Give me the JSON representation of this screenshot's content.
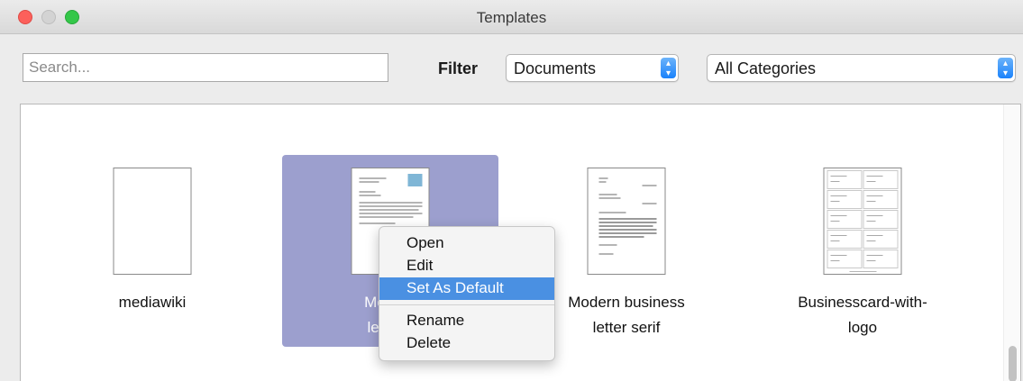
{
  "window": {
    "title": "Templates"
  },
  "search": {
    "placeholder": "Search..."
  },
  "filter": {
    "label": "Filter",
    "type_select": "Documents",
    "category_select": "All Categories"
  },
  "templates": [
    {
      "name": "mediawiki",
      "line1": "mediawiki",
      "line2": ""
    },
    {
      "name": "Modern business letter sans-serif",
      "line1": "Modern",
      "line2": "letter s",
      "selected": true
    },
    {
      "name": "Modern business letter serif",
      "line1": "Modern business",
      "line2": "letter serif"
    },
    {
      "name": "Businesscard-with-logo",
      "line1": "Businesscard-with-",
      "line2": "logo"
    }
  ],
  "context_menu": {
    "open": "Open",
    "edit": "Edit",
    "set_default": "Set As Default",
    "rename": "Rename",
    "delete": "Delete"
  },
  "colors": {
    "selection": "#9c9fce",
    "menu_highlight": "#4a90e2",
    "close": "#fc605b",
    "zoom": "#34c749"
  }
}
